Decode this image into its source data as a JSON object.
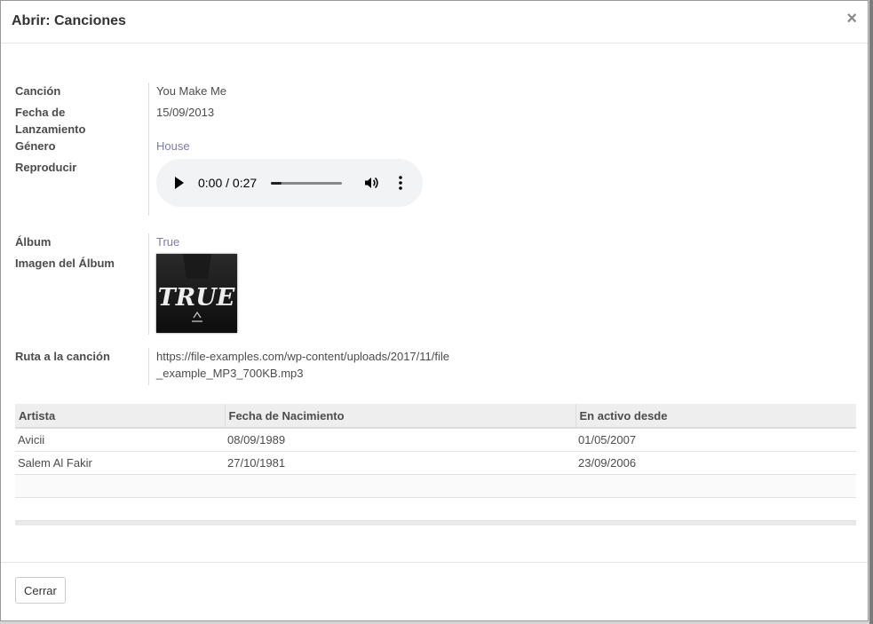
{
  "dialog": {
    "title": "Abrir: Canciones",
    "close_symbol": "×"
  },
  "fields": {
    "cancion": {
      "label": "Canción",
      "value": "You Make Me"
    },
    "fecha": {
      "label": "Fecha de Lanzamiento",
      "value": "15/09/2013"
    },
    "genero": {
      "label": "Género",
      "value": "House"
    },
    "reproducir": {
      "label": "Reproducir"
    },
    "album": {
      "label": "Álbum",
      "value": "True"
    },
    "imagen": {
      "label": "Imagen del Álbum",
      "alt": "TRUE"
    },
    "ruta": {
      "label": "Ruta a la canción",
      "value": "https://file-examples.com/wp-content/uploads/2017/11/file_example_MP3_700KB.mp3"
    }
  },
  "player": {
    "time": "0:00 / 0:27",
    "progress": 0.15,
    "icons": [
      "play-icon",
      "volume-icon",
      "more-options-icon"
    ]
  },
  "table": {
    "columns": [
      "Artista",
      "Fecha de Nacimiento",
      "En activo desde"
    ],
    "rows": [
      [
        "Avicii",
        "08/09/1989",
        "01/05/2007"
      ],
      [
        "Salem Al Fakir",
        "27/10/1981",
        "23/09/2006"
      ]
    ]
  },
  "footer": {
    "close_label": "Cerrar"
  }
}
